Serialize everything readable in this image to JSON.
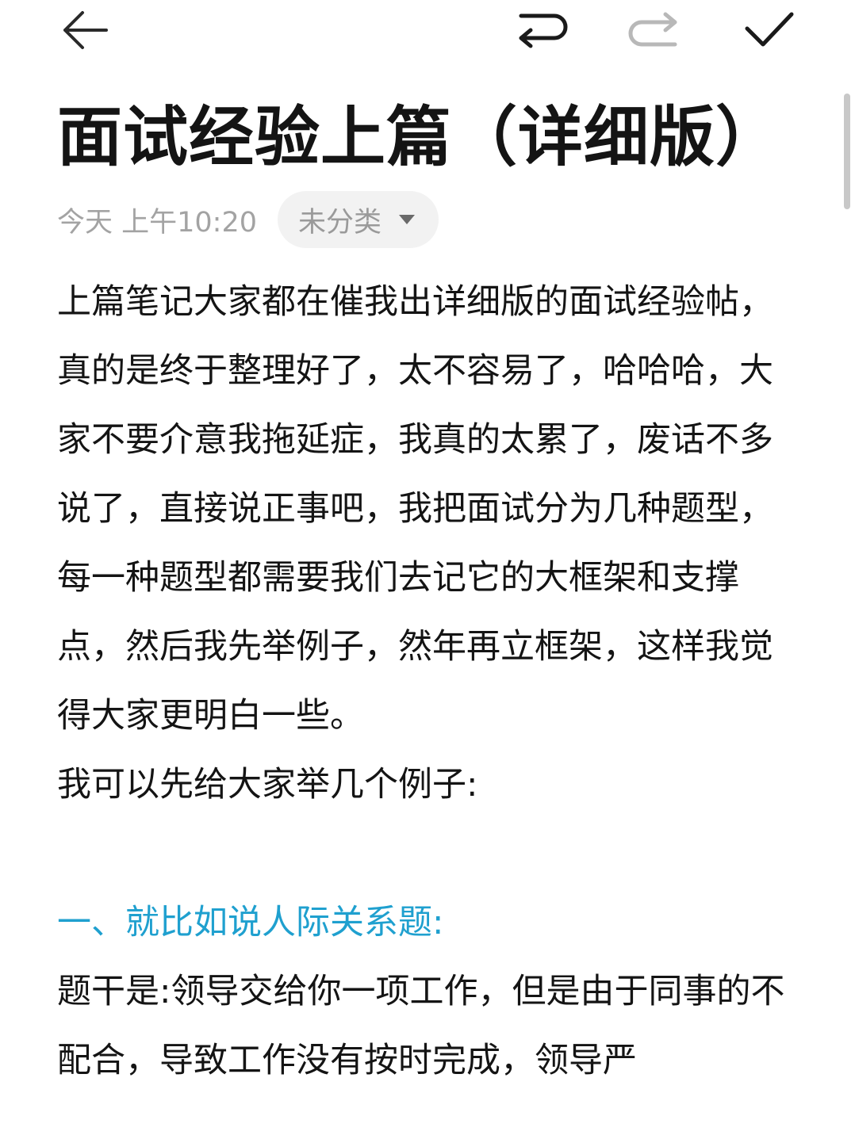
{
  "toolbar": {
    "back_icon": "arrow-left-icon",
    "undo_icon": "undo-icon",
    "redo_icon": "redo-icon",
    "done_icon": "checkmark-icon"
  },
  "note": {
    "title": "面试经验上篇（详细版）",
    "timestamp": "今天 上午10:20",
    "category": "未分类",
    "paragraphs": [
      "上篇笔记大家都在催我出详细版的面试经验帖，真的是终于整理好了，太不容易了，哈哈哈，大家不要介意我拖延症，我真的太累了，废话不多说了，直接说正事吧，我把面试分为几种题型，每一种题型都需要我们去记它的大框架和支撑点，然后我先举例子，然年再立框架，这样我觉得大家更明白一些。",
      "我可以先给大家举几个例子:"
    ],
    "heading": "一、就比如说人际关系题:",
    "after_heading": "题干是:领导交给你一项工作，但是由于同事的不配合，导致工作没有按时完成，领导严"
  },
  "colors": {
    "heading": "#1fa0cf",
    "meta_text": "#a3a3a3",
    "chip_bg": "#f2f2f2"
  }
}
